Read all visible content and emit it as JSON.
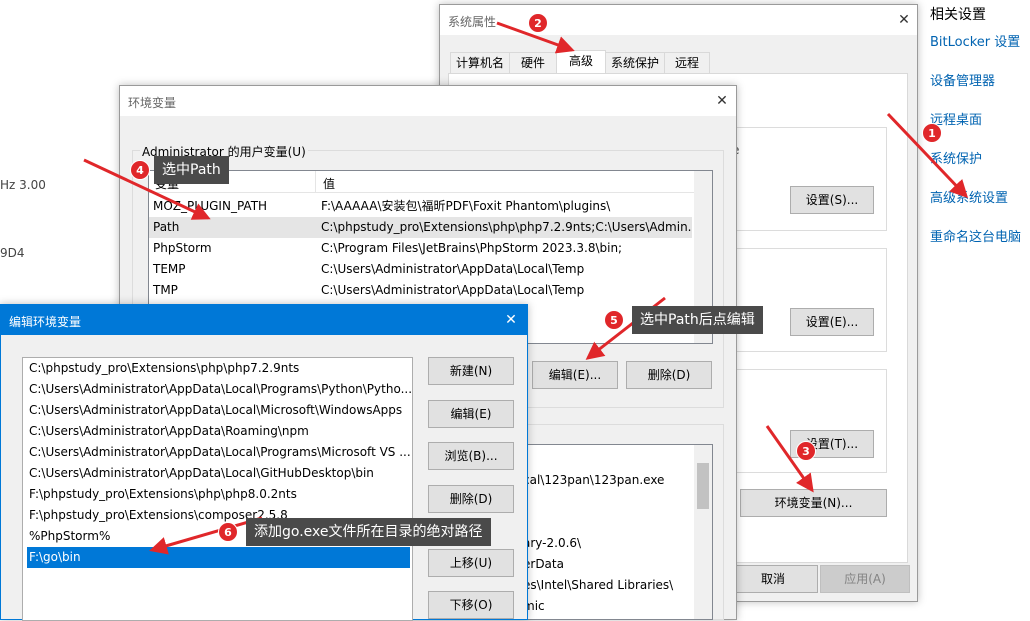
{
  "background": {
    "left_fragments": [
      "Hz   3.00",
      "9D4"
    ],
    "related": {
      "title": "相关设置",
      "links": [
        "BitLocker 设置",
        "设备管理器",
        "远程桌面",
        "系统保护",
        "高级系统设置",
        "重命名这台电脑"
      ]
    }
  },
  "sysprops": {
    "title": "系统属性",
    "close": "✕",
    "tabs": [
      "计算机名",
      "硬件",
      "高级",
      "系统保护",
      "远程"
    ],
    "active_tab": "高级",
    "fragment": "e",
    "settings_s": "设置(S)...",
    "settings_e": "设置(E)...",
    "settings_t": "设置(T)...",
    "env_button": "环境变量(N)...",
    "cancel": "取消",
    "apply": "应用(A)"
  },
  "envvars": {
    "title": "环境变量",
    "close": "✕",
    "user_group_label": "Administrator 的用户变量(U)",
    "columns": [
      "变量",
      "值"
    ],
    "user_rows": [
      {
        "name": "MOZ_PLUGIN_PATH",
        "value": "F:\\AAAAA\\安装包\\福昕PDF\\Foxit Phantom\\plugins\\"
      },
      {
        "name": "Path",
        "value": "C:\\phpstudy_pro\\Extensions\\php\\php7.2.9nts;C:\\Users\\Admin..."
      },
      {
        "name": "PhpStorm",
        "value": "C:\\Program Files\\JetBrains\\PhpStorm 2023.3.8\\bin;"
      },
      {
        "name": "TEMP",
        "value": "C:\\Users\\Administrator\\AppData\\Local\\Temp"
      },
      {
        "name": "TMP",
        "value": "C:\\Users\\Administrator\\AppData\\Local\\Temp"
      }
    ],
    "edit_button": "编辑(E)...",
    "delete_button": "删除(D)",
    "sys_fragments": [
      "cal\\123pan\\123pan.exe",
      "ary-2.0.6\\",
      "erData",
      "es\\Intel\\Shared Libraries\\",
      "mic"
    ]
  },
  "editenv": {
    "title": "编辑环境变量",
    "close": "✕",
    "paths": [
      "C:\\phpstudy_pro\\Extensions\\php\\php7.2.9nts",
      "C:\\Users\\Administrator\\AppData\\Local\\Programs\\Python\\Pytho...",
      "C:\\Users\\Administrator\\AppData\\Local\\Microsoft\\WindowsApps",
      "C:\\Users\\Administrator\\AppData\\Roaming\\npm",
      "C:\\Users\\Administrator\\AppData\\Local\\Programs\\Microsoft VS ...",
      "C:\\Users\\Administrator\\AppData\\Local\\GitHubDesktop\\bin",
      "F:\\phpstudy_pro\\Extensions\\php\\php8.0.2nts",
      "F:\\phpstudy_pro\\Extensions\\composer2.5.8",
      "%PhpStorm%",
      "F:\\go\\bin"
    ],
    "buttons": [
      "新建(N)",
      "编辑(E)",
      "浏览(B)...",
      "删除(D)",
      "上移(U)",
      "下移(O)"
    ]
  },
  "annotations": {
    "badges": [
      "1",
      "2",
      "3",
      "4",
      "5",
      "6"
    ],
    "callout4": "选中Path",
    "callout5": "选中Path后点编辑",
    "callout6": "添加go.exe文件所在目录的绝对路径",
    "color": "#e0272a"
  }
}
